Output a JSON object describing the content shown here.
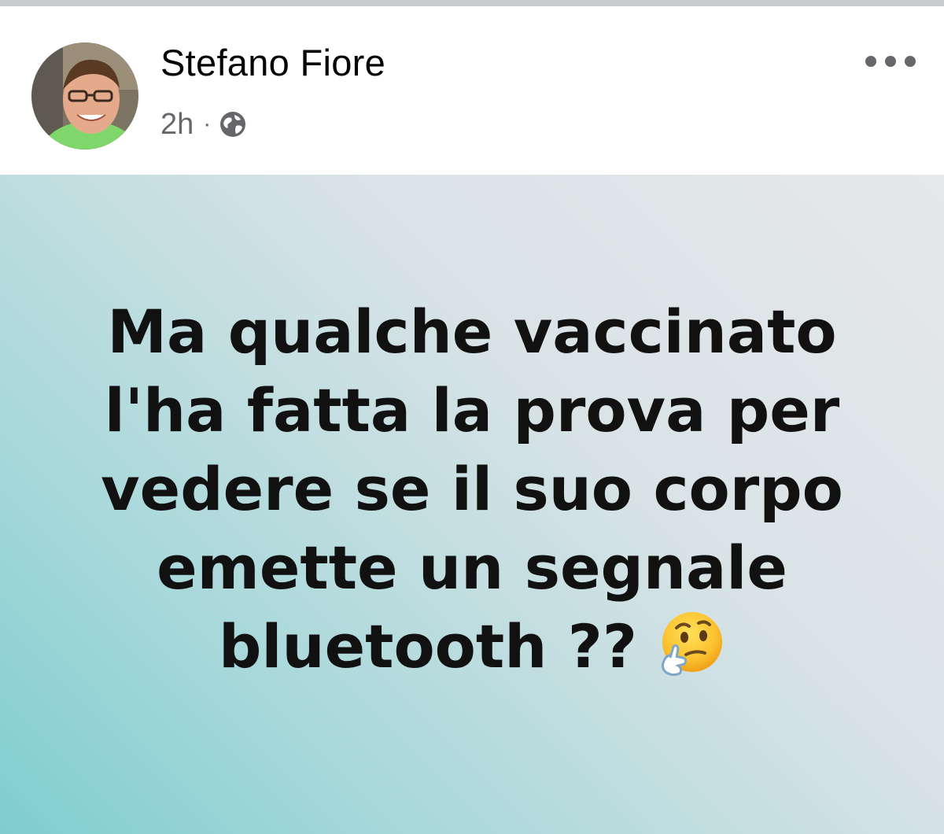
{
  "post": {
    "author_name": "Stefano Fiore",
    "timestamp": "2h",
    "separator": "·",
    "privacy_icon": "globe-icon",
    "more_icon": "more-options-icon",
    "avatar": "profile-photo"
  },
  "card": {
    "lines": [
      "Ma qualche vaccinato",
      "l'ha fatta la prova per",
      "vedere se il suo corpo",
      "emette un segnale",
      "bluetooth ??"
    ],
    "emoji": "thinking-face-icon",
    "background_colors": [
      "#e6e8ea",
      "#7fcdd0"
    ],
    "text_color": "#111111"
  }
}
